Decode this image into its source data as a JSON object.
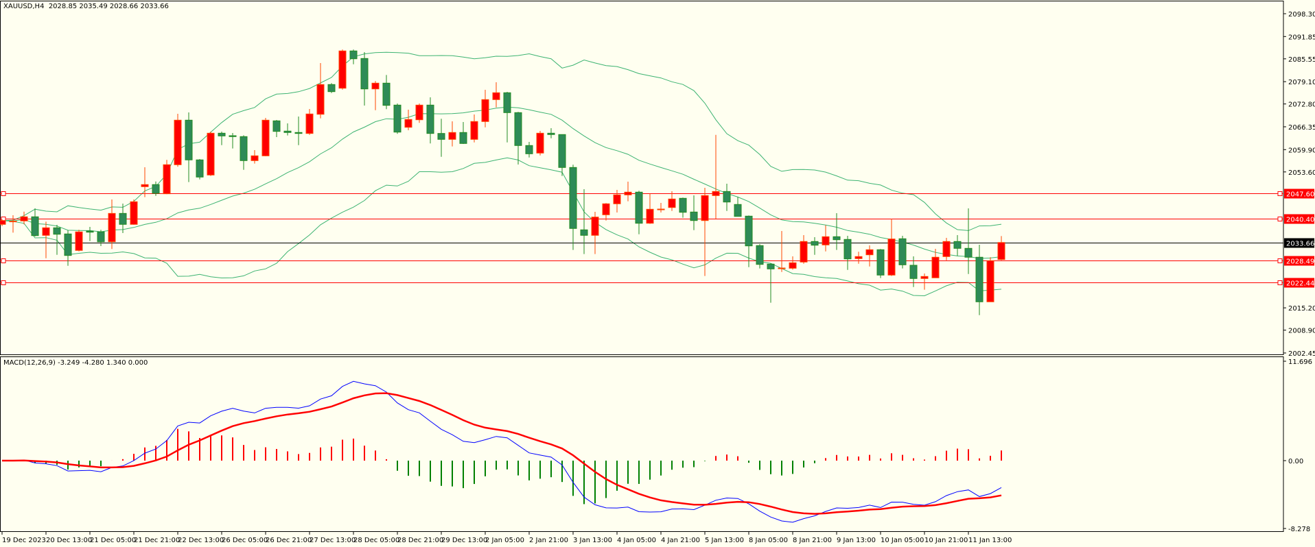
{
  "header": {
    "symbol": "XAUUSD,H4",
    "open": "2028.85",
    "high": "2035.49",
    "low": "2028.66",
    "close": "2033.66"
  },
  "colors": {
    "background": "#FFFFF0",
    "bull_fill": "#FF0000",
    "bull_border": "#FF4500",
    "bear_fill": "#2E8B57",
    "bear_border": "#228B22",
    "bands": "#3CB371",
    "hline": "#FF0000",
    "bid_line": "#000000",
    "macd_line": "#0000FF",
    "signal_line": "#FF0000",
    "hist_pos": "#FF0000",
    "hist_neg": "#008000"
  },
  "chart_data": [
    {
      "type": "candlestick",
      "title": "XAUUSD,H4",
      "indicator": "Bollinger Bands (20, 2)",
      "ylim": [
        2002.45,
        2098.3
      ],
      "y_ticks": [
        "2098.30",
        "2091.85",
        "2085.55",
        "2079.10",
        "2072.80",
        "2066.35",
        "2059.90",
        "2053.60",
        "2015.20",
        "2008.90",
        "2002.45"
      ],
      "x_labels": [
        "19 Dec 2023",
        "20 Dec 13:00",
        "21 Dec 05:00",
        "21 Dec 21:00",
        "22 Dec 13:00",
        "26 Dec 05:00",
        "26 Dec 21:00",
        "27 Dec 13:00",
        "28 Dec 05:00",
        "28 Dec 21:00",
        "29 Dec 13:00",
        "2 Jan 05:00",
        "2 Jan 21:00",
        "3 Jan 13:00",
        "4 Jan 05:00",
        "4 Jan 21:00",
        "5 Jan 13:00",
        "8 Jan 05:00",
        "8 Jan 21:00",
        "9 Jan 13:00",
        "10 Jan 05:00",
        "10 Jan 21:00",
        "11 Jan 13:00"
      ],
      "x_label_every": 4,
      "hlines": [
        {
          "value": 2047.6,
          "label": "2047.60",
          "kind": "level"
        },
        {
          "value": 2040.4,
          "label": "2040.40",
          "kind": "level"
        },
        {
          "value": 2033.66,
          "label": "2033.66",
          "kind": "bid"
        },
        {
          "value": 2028.49,
          "label": "2028.49",
          "kind": "level"
        },
        {
          "value": 2022.44,
          "label": "2022.44",
          "kind": "level"
        }
      ],
      "ohlc": [
        [
          2038.79,
          2040.2,
          2038.27,
          2039.87
        ],
        [
          2039.68,
          2041.36,
          2036.46,
          2039.7
        ],
        [
          2039.76,
          2042.39,
          2038.79,
          2040.92
        ],
        [
          2040.92,
          2043.3,
          2035.36,
          2035.61
        ],
        [
          2035.69,
          2039.56,
          2029.22,
          2037.82
        ],
        [
          2037.82,
          2038.65,
          2030.19,
          2036.0
        ],
        [
          2036.08,
          2037.1,
          2027.09,
          2030.0
        ],
        [
          2031.43,
          2037.24,
          2031.16,
          2036.66
        ],
        [
          2036.91,
          2038.07,
          2034.06,
          2036.58
        ],
        [
          2036.66,
          2037.24,
          2032.65,
          2033.87
        ],
        [
          2033.87,
          2045.82,
          2031.82,
          2041.88
        ],
        [
          2041.88,
          2044.66,
          2036.33,
          2038.79
        ],
        [
          2038.79,
          2045.82,
          2038.65,
          2045.18
        ],
        [
          2049.44,
          2054.92,
          2046.46,
          2050.02
        ],
        [
          2050.02,
          2050.91,
          2046.84,
          2047.56
        ],
        [
          2047.43,
          2057.0,
          2047.31,
          2055.64
        ],
        [
          2055.64,
          2070.02,
          2055.06,
          2068.22
        ],
        [
          2068.22,
          2070.41,
          2050.72,
          2057.0
        ],
        [
          2057.0,
          2057.24,
          2051.49,
          2052.15
        ],
        [
          2052.73,
          2064.99,
          2052.46,
          2064.54
        ],
        [
          2064.54,
          2064.99,
          2061.17,
          2063.77
        ],
        [
          2063.83,
          2064.6,
          2060.21,
          2063.58
        ],
        [
          2063.58,
          2063.96,
          2054.2,
          2056.8
        ],
        [
          2056.8,
          2059.76,
          2055.95,
          2058.15
        ],
        [
          2058.15,
          2068.86,
          2058.02,
          2068.22
        ],
        [
          2068.03,
          2068.28,
          2063.44,
          2065.05
        ],
        [
          2065.13,
          2067.31,
          2063.89,
          2064.74
        ],
        [
          2064.74,
          2069.25,
          2061.17,
          2064.47
        ],
        [
          2064.47,
          2071.38,
          2064.08,
          2069.97
        ],
        [
          2069.89,
          2084.36,
          2068.73,
          2078.29
        ],
        [
          2078.29,
          2078.68,
          2075.89,
          2076.28
        ],
        [
          2077.25,
          2088.17,
          2076.86,
          2087.78
        ],
        [
          2087.78,
          2088.17,
          2084.02,
          2085.57
        ],
        [
          2085.65,
          2087.45,
          2072.35,
          2077.05
        ],
        [
          2077.05,
          2079.26,
          2071.05,
          2078.68
        ],
        [
          2078.68,
          2081.0,
          2071.32,
          2072.41
        ],
        [
          2072.48,
          2072.93,
          2064.35,
          2064.85
        ],
        [
          2066.21,
          2071.19,
          2065.38,
          2068.42
        ],
        [
          2068.34,
          2072.93,
          2067.45,
          2072.48
        ],
        [
          2072.48,
          2074.67,
          2061.64,
          2064.47
        ],
        [
          2064.47,
          2068.61,
          2057.88,
          2062.8
        ],
        [
          2062.8,
          2067.89,
          2060.79,
          2064.74
        ],
        [
          2064.74,
          2067.7,
          2061.5,
          2061.64
        ],
        [
          2062.8,
          2069.83,
          2061.95,
          2067.84
        ],
        [
          2067.84,
          2076.8,
          2066.21,
          2074.03
        ],
        [
          2074.03,
          2078.93,
          2071.83,
          2075.97
        ],
        [
          2075.97,
          2076.22,
          2061.95,
          2070.35
        ],
        [
          2070.35,
          2070.55,
          2055.69,
          2061.06
        ],
        [
          2061.06,
          2062.09,
          2057.69,
          2058.73
        ],
        [
          2058.93,
          2065.18,
          2058.27,
          2064.54
        ],
        [
          2064.54,
          2065.96,
          2063.11,
          2064.16
        ],
        [
          2064.16,
          2064.21,
          2052.46,
          2054.86
        ],
        [
          2054.86,
          2055.64,
          2031.55,
          2037.63
        ],
        [
          2037.24,
          2048.72,
          2030.39,
          2035.69
        ],
        [
          2035.69,
          2042.33,
          2030.39,
          2040.84
        ],
        [
          2041.5,
          2044.8,
          2039.87,
          2044.6
        ],
        [
          2044.6,
          2048.53,
          2042.14,
          2047.12
        ],
        [
          2047.12,
          2050.85,
          2045.3,
          2047.89
        ],
        [
          2047.89,
          2048.28,
          2036.0,
          2039.1
        ],
        [
          2039.1,
          2047.5,
          2038.91,
          2043.05
        ],
        [
          2043.05,
          2044.85,
          2042.14,
          2043.1
        ],
        [
          2043.55,
          2048.14,
          2042.58,
          2045.95
        ],
        [
          2046.15,
          2046.34,
          2040.65,
          2042.2
        ],
        [
          2042.27,
          2046.98,
          2037.16,
          2039.87
        ],
        [
          2039.87,
          2049.11,
          2024.19,
          2046.92
        ],
        [
          2046.92,
          2064.08,
          2040.34,
          2048.08
        ],
        [
          2048.08,
          2050.27,
          2042.58,
          2045.1
        ],
        [
          2044.41,
          2046.53,
          2040.98,
          2041.04
        ],
        [
          2041.11,
          2041.3,
          2026.7,
          2032.71
        ],
        [
          2032.79,
          2033.23,
          2026.32,
          2027.48
        ],
        [
          2027.56,
          2027.81,
          2016.64,
          2026.2
        ],
        [
          2026.39,
          2036.91,
          2025.35,
          2026.45
        ],
        [
          2026.39,
          2029.74,
          2026.0,
          2027.94
        ],
        [
          2028.14,
          2035.75,
          2027.67,
          2033.95
        ],
        [
          2033.95,
          2035.17,
          2030.19,
          2032.9
        ],
        [
          2032.98,
          2038.52,
          2031.16,
          2035.3
        ],
        [
          2035.3,
          2041.94,
          2031.55,
          2034.45
        ],
        [
          2034.53,
          2035.55,
          2025.93,
          2029.03
        ],
        [
          2029.11,
          2031.04,
          2027.67,
          2029.69
        ],
        [
          2030.19,
          2032.84,
          2026.9,
          2031.62
        ],
        [
          2031.62,
          2031.82,
          2023.61,
          2024.46
        ],
        [
          2024.46,
          2040.34,
          2024.19,
          2034.65
        ],
        [
          2034.72,
          2035.55,
          2026.32,
          2027.36
        ],
        [
          2027.23,
          2029.74,
          2021.09,
          2023.49
        ],
        [
          2023.49,
          2024.91,
          2020.32,
          2024.07
        ],
        [
          2023.69,
          2031.88,
          2023.65,
          2029.5
        ],
        [
          2029.69,
          2034.97,
          2028.64,
          2033.95
        ],
        [
          2033.95,
          2035.75,
          2029.88,
          2032.01
        ],
        [
          2032.01,
          2043.3,
          2024.77,
          2029.5
        ],
        [
          2029.5,
          2033.04,
          2013.15,
          2016.91
        ],
        [
          2016.91,
          2029.5,
          2016.87,
          2028.53
        ],
        [
          2028.85,
          2035.49,
          2028.66,
          2033.66
        ]
      ]
    },
    {
      "type": "line+histogram",
      "title": "MACD(12,26,9)",
      "label": "MACD(12,26,9) -3.249 -4.280 1.340 0.000",
      "values": {
        "macd": -3.249,
        "signal": -4.28,
        "histogram": 1.34,
        "extra": 0.0
      },
      "ylim": [
        -8.278,
        11.696
      ],
      "y_ticks": [
        "11.696",
        "0.00",
        "-8.278"
      ]
    }
  ]
}
